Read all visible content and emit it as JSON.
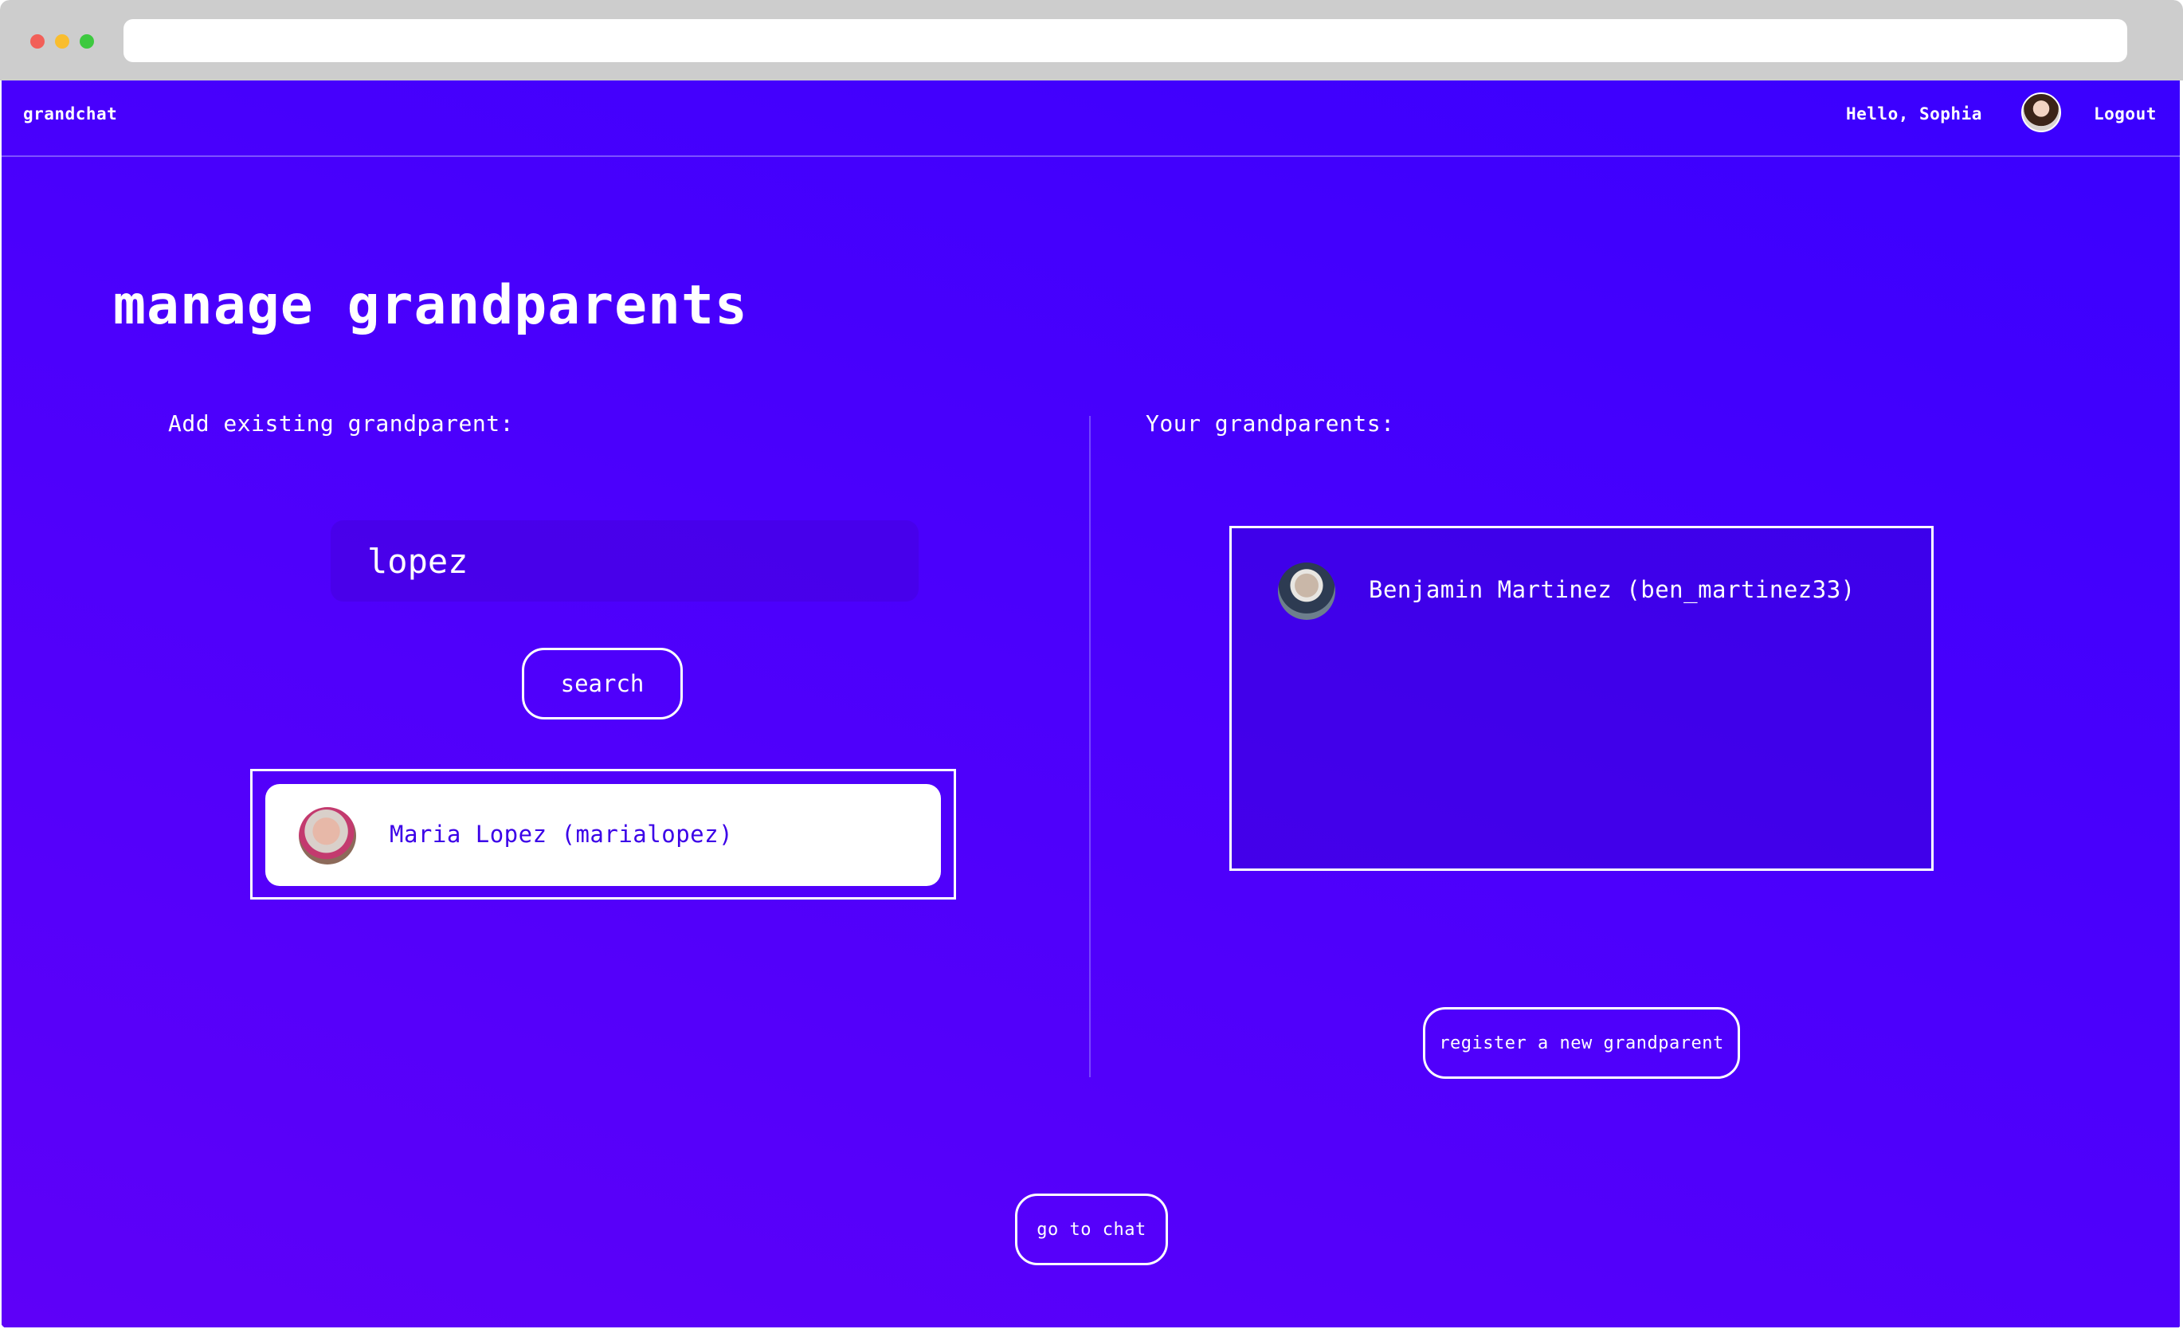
{
  "navbar": {
    "brand": "grandchat",
    "greeting": "Hello, Sophia",
    "logout_label": "Logout"
  },
  "page": {
    "title": "manage grandparents"
  },
  "add_section": {
    "label": "Add existing grandparent:",
    "search_value": "lopez",
    "search_button_label": "search",
    "results": [
      {
        "display": "Maria Lopez (marialopez)"
      }
    ]
  },
  "your_section": {
    "label": "Your grandparents:",
    "grandparents": [
      {
        "display": "Benjamin Martinez (ben_martinez33)"
      }
    ],
    "register_button_label": "register a new grandparent"
  },
  "footer": {
    "chat_button_label": "go to chat"
  }
}
